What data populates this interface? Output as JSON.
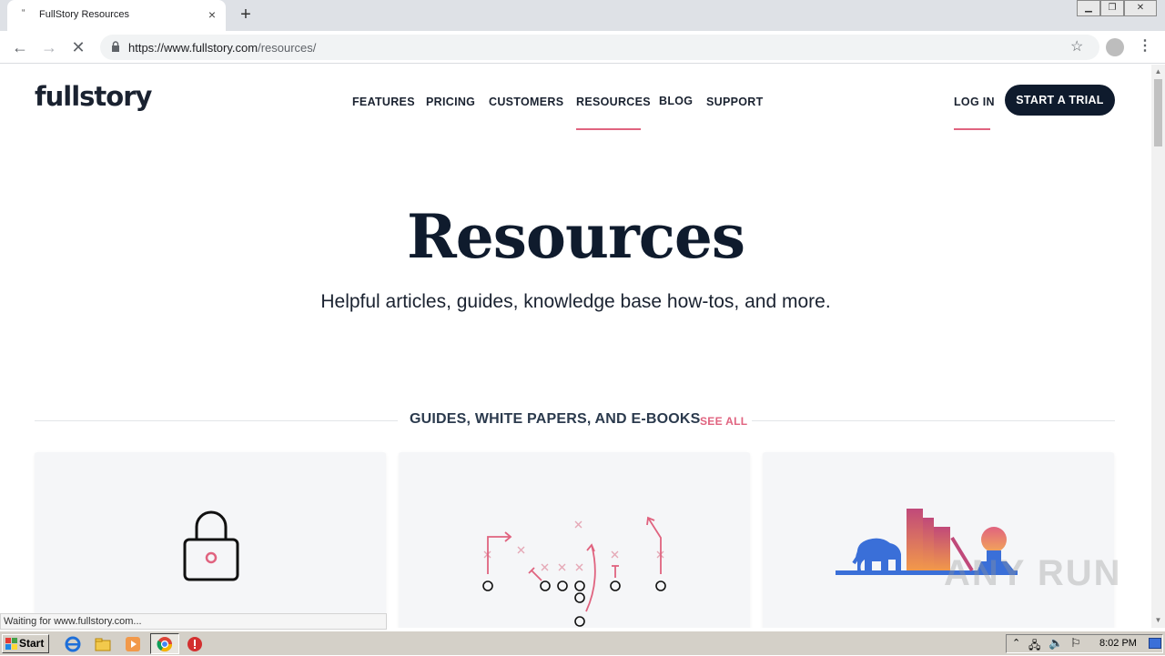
{
  "browser": {
    "tab_title": "FullStory Resources",
    "tab_close": "×",
    "new_tab": "+",
    "url_host": "https://www.fullstory.com",
    "url_path": "/resources/"
  },
  "site": {
    "logo": "fullstory",
    "nav": [
      "FEATURES",
      "PRICING",
      "CUSTOMERS",
      "RESOURCES",
      "BLOG",
      "SUPPORT"
    ],
    "login": "LOG IN",
    "cta": "START A TRIAL"
  },
  "hero": {
    "title": "Resources",
    "subtitle": "Helpful articles, guides, knowledge base how-tos, and more."
  },
  "section": {
    "title": "GUIDES, WHITE PAPERS, AND E-BOOKS",
    "see_all": "SEE ALL"
  },
  "status": "Waiting for www.fullstory.com...",
  "taskbar": {
    "start": "Start",
    "clock": "8:02 PM"
  },
  "watermark": "ANY RUN",
  "colors": {
    "accent": "#e0637f",
    "navy": "#0f1b2d"
  }
}
